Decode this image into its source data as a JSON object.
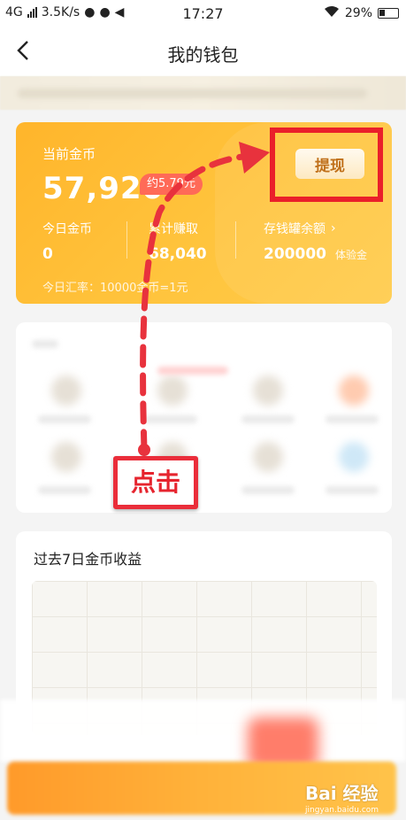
{
  "status_bar": {
    "network": "4G",
    "speed": "3.5K/s",
    "time": "17:27",
    "battery": "29%"
  },
  "nav": {
    "title": "我的钱包"
  },
  "coin_card": {
    "current_label": "当前金币",
    "current_value": "57,920",
    "approx_badge": "约5.79元",
    "withdraw_label": "提现",
    "stats": [
      {
        "label": "今日金币",
        "value": "0"
      },
      {
        "label": "累计赚取",
        "value": "68,040"
      },
      {
        "label": "存钱罐余额",
        "value": "200000",
        "unit": "体验金"
      }
    ],
    "rate_text": "今日汇率：10000金币=1元"
  },
  "income": {
    "title": "过去7日金币收益"
  },
  "annotation": {
    "click_label": "点击"
  },
  "watermark": {
    "brand": "Bai 经验",
    "url": "jingyan.baidu.com"
  },
  "colors": {
    "card_orange": "#ffb52b",
    "annotation_red": "#ea1f2a"
  }
}
